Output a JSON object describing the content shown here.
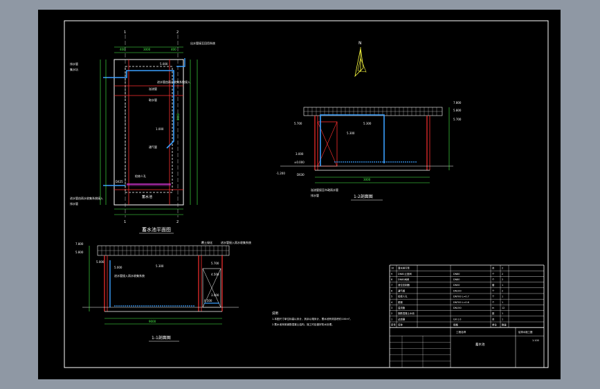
{
  "drawing": {
    "north": "N",
    "plan": {
      "title": "蓄水池平面图",
      "section_marks": [
        "1",
        "2",
        "1",
        "2"
      ],
      "bottom_label": "蓄水池",
      "notes": [
        "进水管由雨水收集系统接入",
        "溢流管",
        "取水管",
        "通气管",
        "检修人孔",
        "排水管",
        "集水坑",
        "出水管接至回用系统"
      ],
      "dims": [
        "400",
        "3000",
        "400",
        "9000",
        "D425"
      ],
      "levels": [
        "5.000",
        "1.000",
        "-0.500"
      ]
    },
    "section_11": {
      "title": "1-1剖面图",
      "levels": [
        "7.800",
        "5.800",
        "5.000",
        "5.300",
        "5.700",
        "4.500",
        "3.000",
        "0.500"
      ],
      "notes": [
        "覆土绿化",
        "进水管接入雨水收集系统"
      ],
      "dims": [
        "3000",
        "9000"
      ]
    },
    "section_22": {
      "title": "1-2剖面图",
      "levels": [
        "7.800",
        "5.800",
        "5.700",
        "3.000",
        "5.300",
        "±0.000",
        "-1.200",
        "D630"
      ],
      "notes": [
        "溢流管接至市政雨水管",
        "排水管"
      ],
      "dims": [
        "3000",
        "3000"
      ]
    },
    "notes": {
      "label": "说明",
      "lines": [
        "1.本图尺寸单位标高以米计，其余以毫米计，蓄水池有效容积约100m³。",
        "2.蓄水池采用钢筋混凝土结构，施工时应做好防水处理。"
      ]
    },
    "title_block": {
      "rows": [
        {
          "no": "10",
          "name": "潜水排污泵",
          "spec": "",
          "unit": "台",
          "qty": "2"
        },
        {
          "no": "9",
          "name": "DN80止回阀",
          "spec": "DN80",
          "unit": "个",
          "qty": "2"
        },
        {
          "no": "8",
          "name": "DN80闸阀",
          "spec": "DN80",
          "unit": "个",
          "qty": "2"
        },
        {
          "no": "7",
          "name": "液位控制器",
          "spec": "DN50",
          "unit": "套",
          "qty": "1"
        },
        {
          "no": "6",
          "name": "通气帽",
          "spec": "DN100",
          "unit": "个",
          "qty": "2"
        },
        {
          "no": "5",
          "name": "检修人孔",
          "spec": "DN700 L=0.7",
          "unit": "个",
          "qty": "1"
        },
        {
          "no": "4",
          "name": "爬梯",
          "spec": "DN700 L=0.6",
          "unit": "个",
          "qty": "1"
        },
        {
          "no": "3",
          "name": "溢流管",
          "spec": "DN150",
          "unit": "m",
          "qty": "12"
        },
        {
          "no": "2",
          "name": "钢筋混凝土水池",
          "spec": "",
          "unit": "座",
          "qty": "1"
        },
        {
          "no": "1",
          "name": "过滤器",
          "spec": "GX-1.0",
          "unit": "台",
          "qty": "1"
        }
      ],
      "header": [
        "序号",
        "名称",
        "规格",
        "单位",
        "数量"
      ],
      "drawing_name": "蓄水池",
      "project": "工程名称",
      "scale": "1:100",
      "sheet_code": "给排水施工图"
    }
  }
}
